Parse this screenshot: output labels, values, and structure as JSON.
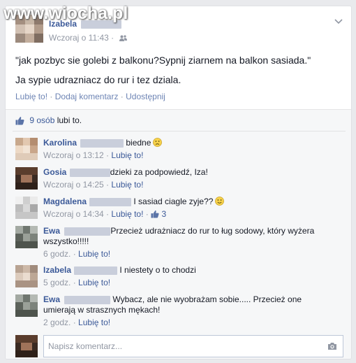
{
  "watermark": {
    "text": "www.wiocha.pl"
  },
  "post": {
    "author": "Izabela",
    "timestamp": "Wczoraj o 11:43",
    "audience_icon": "friends-icon",
    "menu_icon": "chevron-down-icon",
    "lines": [
      "\"jak pozbyc sie golebi z balkonu?Sypnij ziarnem na balkon sasiada.\"",
      "Ja sypie udrazniacz do rur i tez dziala."
    ],
    "actions": {
      "like": "Lubię to!",
      "comment": "Dodaj komentarz",
      "share": "Udostępnij",
      "separator": "·"
    }
  },
  "likes": {
    "icon": "thumbs-up-icon",
    "count": "9 osób",
    "suffix": "lubi to."
  },
  "comments": [
    {
      "name": "Karolina",
      "text": "biedne",
      "time": "Wczoraj o 13:12",
      "like": "Lubię to!",
      "emoji": "frown-icon"
    },
    {
      "name": "Gosia",
      "text": "dzieki za podpowiedź, Iza!",
      "time": "Wczoraj o 14:25",
      "like": "Lubię to!"
    },
    {
      "name": "Magdalena",
      "text": "I sasiad ciagle zyje??",
      "time": "Wczoraj o 14:34",
      "like": "Lubię to!",
      "likes_count": "3",
      "emoji": "smile-icon"
    },
    {
      "name": "Ewa",
      "text": "Przecież udrażniacz do rur to ług sodowy, który wyżera wszystko!!!!!",
      "time": "6 godz.",
      "like": "Lubię to!"
    },
    {
      "name": "Izabela",
      "text": "I niestety o to chodzi",
      "time": "5 godz.",
      "like": "Lubię to!"
    },
    {
      "name": "Ewa",
      "text": "Wybacz, ale nie wyobrażam sobie..... Przecież one umierają w strasznych mękach!",
      "time": "2 godz.",
      "like": "Lubię to!"
    }
  ],
  "composer": {
    "placeholder": "Napisz komentarz...",
    "icon": "camera-icon"
  },
  "colors": {
    "link": "#3b5998",
    "meta": "#9197a3",
    "background": "#e9eaed",
    "ufi": "#f6f7f8"
  }
}
